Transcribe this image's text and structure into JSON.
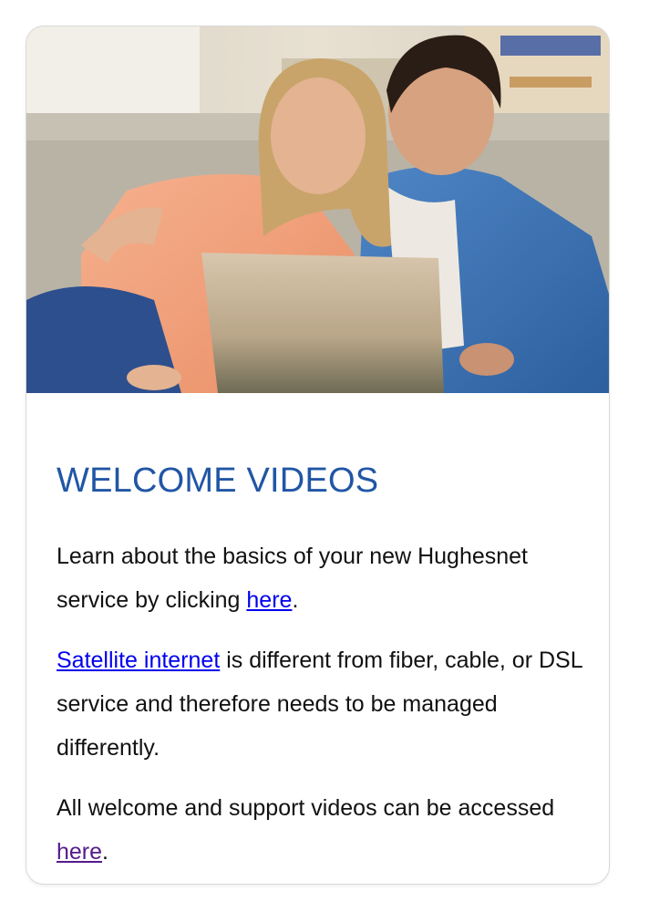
{
  "card": {
    "image_alt": "Couple smiling at a laptop on a couch",
    "title": "WELCOME VIDEOS",
    "paragraph1": {
      "text_before": "Learn about the basics of your new Hughesnet service by clicking ",
      "link_text": "here",
      "text_after": "."
    },
    "paragraph2": {
      "link_text": "Satellite internet",
      "text_after": " is different from fiber, cable, or DSL service and therefore needs to be managed differently."
    },
    "paragraph3": {
      "text_before": "All welcome and support videos can be accessed ",
      "link_text": "here",
      "text_after": "."
    }
  },
  "colors": {
    "title": "#2156a5",
    "link": "#0000ee",
    "visited_link": "#551a8b",
    "body_text": "#111111"
  }
}
